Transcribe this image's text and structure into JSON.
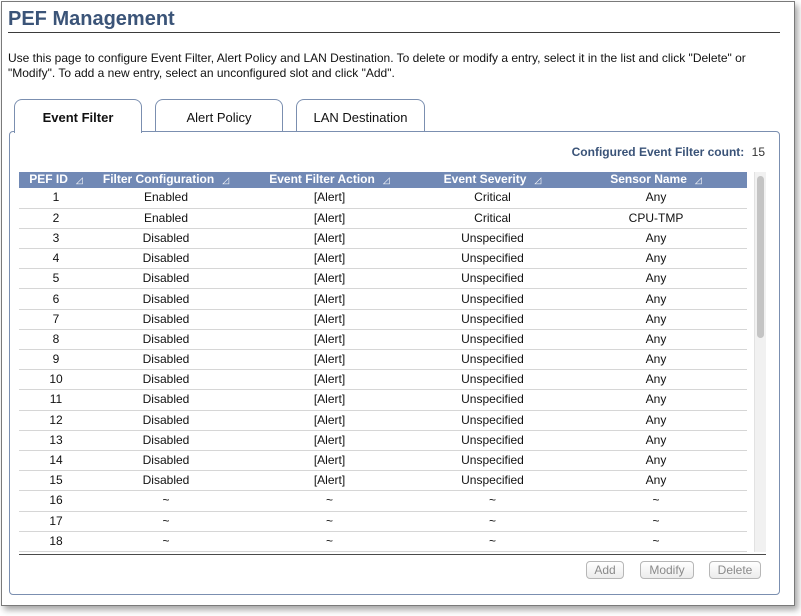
{
  "page": {
    "title": "PEF Management",
    "description": "Use this page to configure Event Filter, Alert Policy and LAN Destination. To delete or modify a entry, select it in the list and click \"Delete\" or \"Modify\". To add a new entry, select an unconfigured slot and click \"Add\"."
  },
  "tabs": [
    {
      "label": "Event Filter",
      "active": true
    },
    {
      "label": "Alert Policy",
      "active": false
    },
    {
      "label": "LAN Destination",
      "active": false
    }
  ],
  "summary": {
    "count_label": "Configured Event Filter count:",
    "count_value": "15"
  },
  "table": {
    "columns": [
      "PEF ID",
      "Filter Configuration",
      "Event Filter Action",
      "Event Severity",
      "Sensor Name"
    ],
    "sort_icon": "sort-triangle-icon",
    "rows": [
      [
        "1",
        "Enabled",
        "[Alert]",
        "Critical",
        "Any"
      ],
      [
        "2",
        "Enabled",
        "[Alert]",
        "Critical",
        "CPU-TMP"
      ],
      [
        "3",
        "Disabled",
        "[Alert]",
        "Unspecified",
        "Any"
      ],
      [
        "4",
        "Disabled",
        "[Alert]",
        "Unspecified",
        "Any"
      ],
      [
        "5",
        "Disabled",
        "[Alert]",
        "Unspecified",
        "Any"
      ],
      [
        "6",
        "Disabled",
        "[Alert]",
        "Unspecified",
        "Any"
      ],
      [
        "7",
        "Disabled",
        "[Alert]",
        "Unspecified",
        "Any"
      ],
      [
        "8",
        "Disabled",
        "[Alert]",
        "Unspecified",
        "Any"
      ],
      [
        "9",
        "Disabled",
        "[Alert]",
        "Unspecified",
        "Any"
      ],
      [
        "10",
        "Disabled",
        "[Alert]",
        "Unspecified",
        "Any"
      ],
      [
        "11",
        "Disabled",
        "[Alert]",
        "Unspecified",
        "Any"
      ],
      [
        "12",
        "Disabled",
        "[Alert]",
        "Unspecified",
        "Any"
      ],
      [
        "13",
        "Disabled",
        "[Alert]",
        "Unspecified",
        "Any"
      ],
      [
        "14",
        "Disabled",
        "[Alert]",
        "Unspecified",
        "Any"
      ],
      [
        "15",
        "Disabled",
        "[Alert]",
        "Unspecified",
        "Any"
      ],
      [
        "16",
        "~",
        "~",
        "~",
        "~"
      ],
      [
        "17",
        "~",
        "~",
        "~",
        "~"
      ],
      [
        "18",
        "~",
        "~",
        "~",
        "~"
      ]
    ]
  },
  "buttons": {
    "add": "Add",
    "modify": "Modify",
    "delete": "Delete"
  },
  "colors": {
    "title": "#3b5478",
    "header_bg": "#7189b5",
    "tab_border": "#7b8fb0"
  }
}
